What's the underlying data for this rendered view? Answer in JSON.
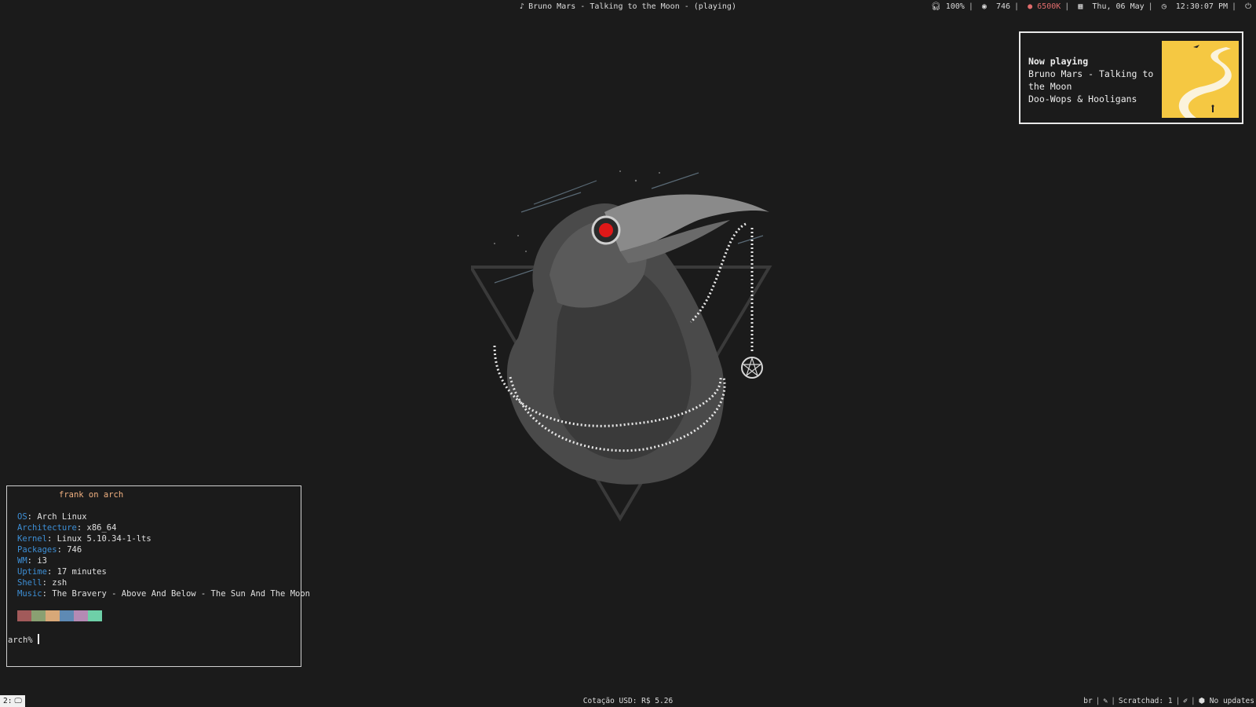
{
  "topbar": {
    "track": "Bruno Mars - Talking to the Moon - (playing)",
    "volume": "100%",
    "packages": "746",
    "color_temp": "6500K",
    "date": "Thu, 06 May",
    "time": "12:30:07 PM",
    "icons": [
      "music-note-icon",
      "headphones-icon",
      "ghost-icon",
      "temperature-pin-icon",
      "calendar-icon",
      "clock-icon",
      "power-icon"
    ]
  },
  "notification": {
    "heading": "Now playing",
    "track": "Bruno Mars - Talking to the Moon",
    "album": "Doo-Wops & Hooligans",
    "album_art_colors": {
      "background": "#f5c842",
      "road": "#ffffff"
    }
  },
  "terminal": {
    "title": "frank on arch",
    "info": [
      {
        "key": "OS",
        "value": "Arch Linux"
      },
      {
        "key": "Architecture",
        "value": "x86_64"
      },
      {
        "key": "Kernel",
        "value": "Linux 5.10.34-1-lts"
      },
      {
        "key": "Packages",
        "value": "746"
      },
      {
        "key": "WM",
        "value": "i3"
      },
      {
        "key": "Uptime",
        "value": "17 minutes"
      },
      {
        "key": "Shell",
        "value": "zsh"
      },
      {
        "key": "Music",
        "value": "The Bravery - Above And Below - The Sun And The Moon"
      }
    ],
    "palette": [
      "#a25a5a",
      "#8aa072",
      "#d8a878",
      "#5e8ab4",
      "#b48ab4",
      "#6ed0a8"
    ],
    "prompt": "arch%"
  },
  "bottombar": {
    "workspace": "2:",
    "currency": "Cotação USD: R$ 5.26",
    "layout": "br",
    "scratchpad": "Scratchad: 1",
    "updates": "No updates",
    "icons": [
      "monitor-icon",
      "pencil-icon",
      "no-pen-icon",
      "package-icon"
    ]
  },
  "colors": {
    "background": "#1b1b1b",
    "accent_key": "#3d8fd6",
    "title": "#f0b080",
    "raven_eye": "#e01818"
  }
}
